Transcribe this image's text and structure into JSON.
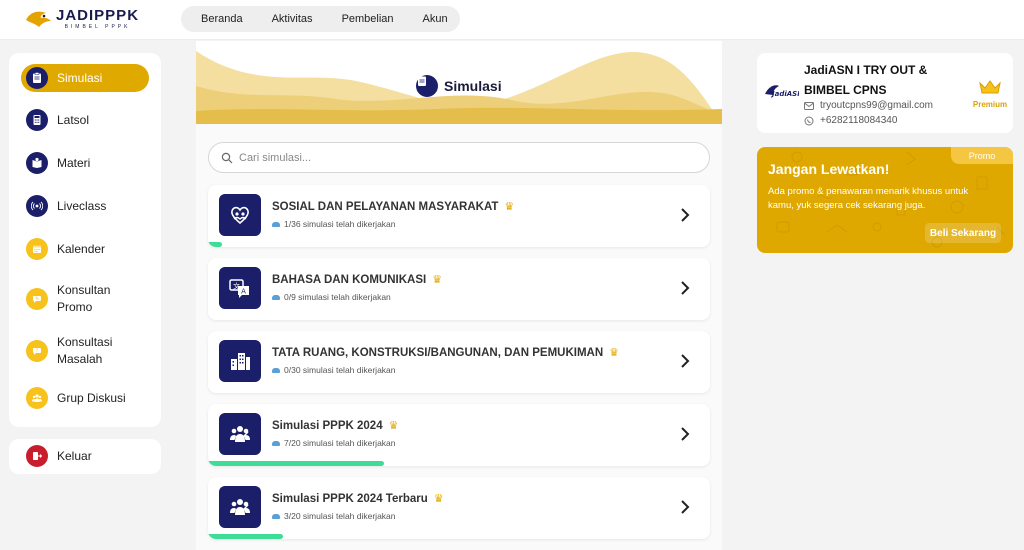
{
  "brand": {
    "name": "JADIPPPK",
    "tagline": "BIMBEL PPPK"
  },
  "nav": {
    "items": [
      "Beranda",
      "Aktivitas",
      "Pembelian",
      "Akun"
    ]
  },
  "sidebar": {
    "items": [
      {
        "label": "Simulasi",
        "icon": "clipboard-icon"
      },
      {
        "label": "Latsol",
        "icon": "calculator-icon"
      },
      {
        "label": "Materi",
        "icon": "book-icon"
      },
      {
        "label": "Liveclass",
        "icon": "broadcast-icon"
      },
      {
        "label": "Kalender",
        "icon": "calendar-icon"
      },
      {
        "label": "Konsultan Promo",
        "icon": "chat-icon"
      },
      {
        "label": "Konsultasi Masalah",
        "icon": "chat-question-icon"
      },
      {
        "label": "Grup Diskusi",
        "icon": "group-icon"
      }
    ],
    "logout": "Keluar"
  },
  "main": {
    "title": "Simulasi",
    "search_placeholder": "Cari simulasi...",
    "cards": [
      {
        "title": "SOSIAL DAN PELAYANAN MASYARAKAT",
        "sub": "1/36 simulasi telah dikerjakan",
        "progress": 0.028
      },
      {
        "title": "BAHASA DAN KOMUNIKASI",
        "sub": "0/9 simulasi telah dikerjakan",
        "progress": 0
      },
      {
        "title": "TATA RUANG, KONSTRUKSI/BANGUNAN, DAN PEMUKIMAN",
        "sub": "0/30 simulasi telah dikerjakan",
        "progress": 0
      },
      {
        "title": "Simulasi PPPK 2024",
        "sub": "7/20 simulasi telah dikerjakan",
        "progress": 0.35
      },
      {
        "title": "Simulasi PPPK 2024 Terbaru",
        "sub": "3/20 simulasi telah dikerjakan",
        "progress": 0.15
      }
    ]
  },
  "profile": {
    "name": "JadiASN I TRY OUT & BIMBEL CPNS",
    "logo_text": "JadiASN",
    "email": "tryoutcpns99@gmail.com",
    "phone": "+6282118084340",
    "badge": "Premium"
  },
  "promo": {
    "badge": "Promo",
    "title": "Jangan Lewatkan!",
    "text": "Ada promo & penawaran menarik khusus untuk kamu, yuk segera cek sekarang juga.",
    "button": "Beli Sekarang"
  },
  "colors": {
    "navy": "#1b1f6a",
    "gold": "#dfa900",
    "yellow": "#f7c21b",
    "green": "#3ddc97",
    "red": "#c81e2c"
  }
}
